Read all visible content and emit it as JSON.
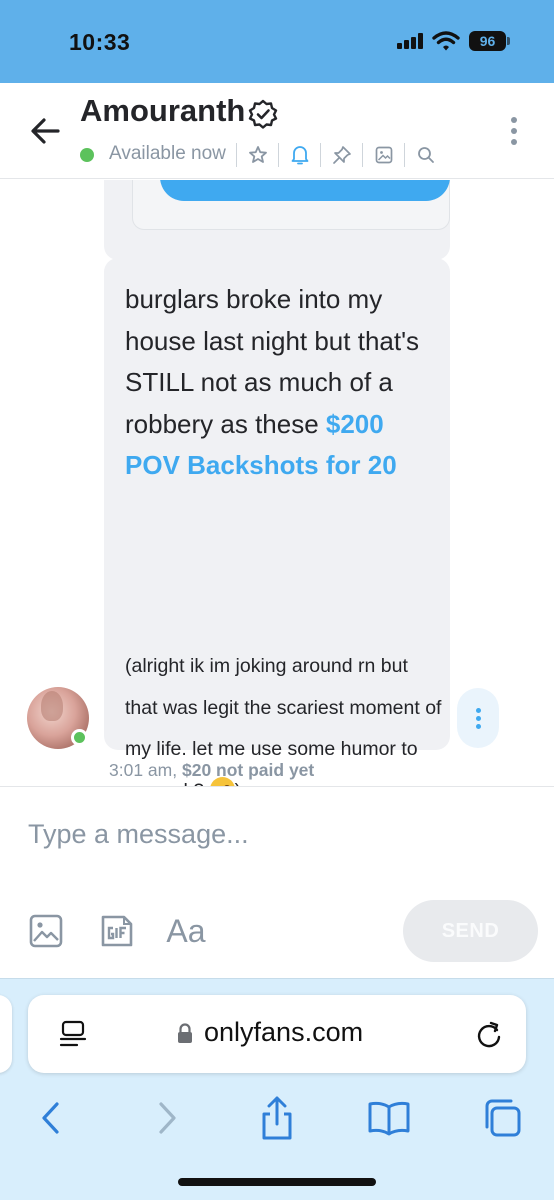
{
  "status_bar": {
    "time": "10:33",
    "battery": "96",
    "background": "#5fb0ea"
  },
  "chat_header": {
    "contact_name": "Amouranth",
    "availability": "Available now",
    "icons": [
      "back-arrow-icon",
      "verified-icon",
      "star-icon",
      "bell-icon",
      "pin-icon",
      "image-icon",
      "search-icon",
      "more-vertical-icon"
    ]
  },
  "message": {
    "main_text": "burglars broke into my house last night but that's STILL not as much of a robbery as these ",
    "link_text": "$200 POV Backshots for 20",
    "aside_text": "(alright ik im joking around rn but that was legit the scariest moment of my life. let me use some humor to cope ok? ",
    "aside_end": ")",
    "time": "3:01 am,",
    "price_status": "$20 not paid yet"
  },
  "compose": {
    "placeholder": "Type a message...",
    "font_tool": "Aa",
    "send_label": "SEND"
  },
  "browser": {
    "url": "onlyfans.com"
  },
  "colors": {
    "accent": "#3fa9f0",
    "online": "#5cc25c",
    "muted": "#8a96a3",
    "bubble": "#f0f1f4"
  }
}
